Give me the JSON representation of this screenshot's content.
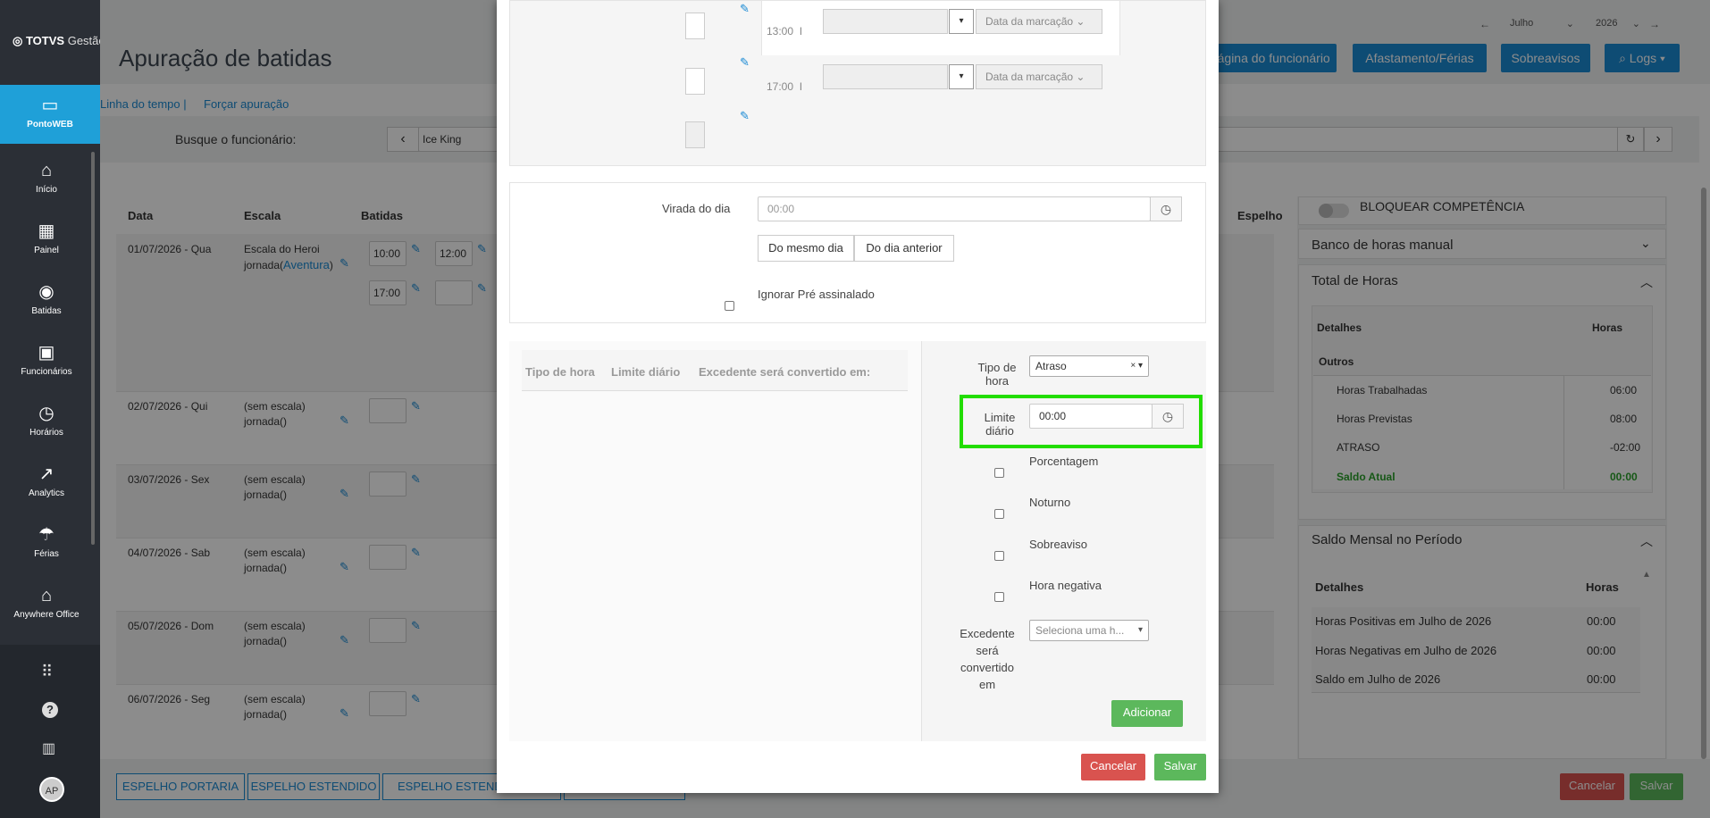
{
  "app": {
    "logo_brand": "TOTVS",
    "logo_text": "Gestão",
    "page_title": "Apuração de batidas"
  },
  "sidebar": {
    "items": [
      {
        "label": "PontoWEB",
        "icon": "monitor-icon",
        "glyph": "🖥"
      },
      {
        "label": "Início",
        "icon": "home-icon",
        "glyph": "⌂"
      },
      {
        "label": "Painel",
        "icon": "dashboard-icon",
        "glyph": "▦"
      },
      {
        "label": "Batidas",
        "icon": "fingerprint-icon",
        "glyph": "◉"
      },
      {
        "label": "Funcionários",
        "icon": "badge-icon",
        "glyph": "▣"
      },
      {
        "label": "Horários",
        "icon": "clock-icon",
        "glyph": "◷"
      },
      {
        "label": "Analytics",
        "icon": "trend-icon",
        "glyph": "↗"
      },
      {
        "label": "Férias",
        "icon": "umbrella-icon",
        "glyph": "☂"
      },
      {
        "label": "Anywhere Office",
        "icon": "house-icon",
        "glyph": "⌂"
      }
    ],
    "bottom_icons": [
      "apps-grid-icon",
      "help-icon",
      "building-icon"
    ],
    "avatar": "AP"
  },
  "header": {
    "month": "Julho",
    "year": "2026",
    "buttons": {
      "employee_page": "Página do funcionário",
      "leave": "Afastamento/Férias",
      "oncall": "Sobreavisos",
      "logs": "Logs"
    }
  },
  "links": {
    "timeline": "Linha do tempo",
    "force": "Forçar apuração"
  },
  "search": {
    "label": "Busque o funcionário:",
    "value": "Ice King"
  },
  "table": {
    "headers": {
      "date": "Data",
      "scale": "Escala",
      "punches": "Batidas",
      "mirror": "Espelho"
    },
    "rows": [
      {
        "date": "01/07/2026 - Qua",
        "scale": "Escala do Heroi",
        "journey_prefix": "jornada(",
        "journey_link": "Aventura",
        "journey_suffix": ")",
        "punches": [
          "10:00",
          "12:00",
          "17:00",
          ""
        ]
      },
      {
        "date": "02/07/2026 - Qui",
        "scale": "(sem escala)",
        "journey": "jornada()"
      },
      {
        "date": "03/07/2026 - Sex",
        "scale": "(sem escala)",
        "journey": "jornada()"
      },
      {
        "date": "04/07/2026 - Sab",
        "scale": "(sem escala)",
        "journey": "jornada()"
      },
      {
        "date": "05/07/2026 - Dom",
        "scale": "(sem escala)",
        "journey": "jornada()"
      },
      {
        "date": "06/07/2026 - Seg",
        "scale": "(sem escala)",
        "journey": "jornada()"
      }
    ]
  },
  "footer": {
    "mirror_portaria": "ESPELHO PORTARIA",
    "mirror_ext": "ESPELHO ESTENDIDO",
    "mirror_ext2": "ESPELHO ESTENDI",
    "cancel": "Cancelar",
    "save": "Salvar"
  },
  "right": {
    "block": "BLOQUEAR COMPETÊNCIA",
    "bank": "Banco de horas manual",
    "total_title": "Total de Horas",
    "total_headers": {
      "details": "Detalhes",
      "hours": "Horas"
    },
    "group": "Outros",
    "total_rows": [
      {
        "label": "Horas Trabalhadas",
        "value": "06:00"
      },
      {
        "label": "Horas Previstas",
        "value": "08:00"
      },
      {
        "label": "ATRASO",
        "value": "-02:00"
      },
      {
        "label": "Saldo Atual",
        "value": "00:00"
      }
    ],
    "monthly_title": "Saldo Mensal no Período",
    "monthly_rows": [
      {
        "label": "Horas Positivas em Julho de 2026",
        "value": "00:00"
      },
      {
        "label": "Horas Negativas em Julho de 2026",
        "value": "00:00"
      },
      {
        "label": "Saldo em Julho de 2026",
        "value": "00:00"
      }
    ]
  },
  "modal": {
    "times": [
      "13:00",
      "17:00"
    ],
    "date_placeholder": "Data da marcação",
    "turn_label": "Virada do dia",
    "turn_placeholder": "00:00",
    "same_day": "Do mesmo dia",
    "prev_day": "Do dia anterior",
    "ignore_pre": "Ignorar Pré assinalado",
    "grid_headers": {
      "type": "Tipo de hora",
      "limit": "Limite diário",
      "excess": "Excedente será convertido em:"
    },
    "type_label_1": "Tipo de",
    "type_label_2": "hora",
    "type_value": "Atraso",
    "limit_label_1": "Limite",
    "limit_label_2": "diário",
    "limit_value": "00:00",
    "checks": [
      "Porcentagem",
      "Noturno",
      "Sobreaviso",
      "Hora negativa"
    ],
    "excess_label": [
      "Excedente",
      "será",
      "convertido",
      "em"
    ],
    "excess_placeholder": "Seleciona uma h...",
    "add": "Adicionar",
    "cancel": "Cancelar",
    "save": "Salvar"
  },
  "colors": {
    "accent": "#1a8ad4",
    "highlight": "#22dd00",
    "saldo": "#2aa02a"
  }
}
